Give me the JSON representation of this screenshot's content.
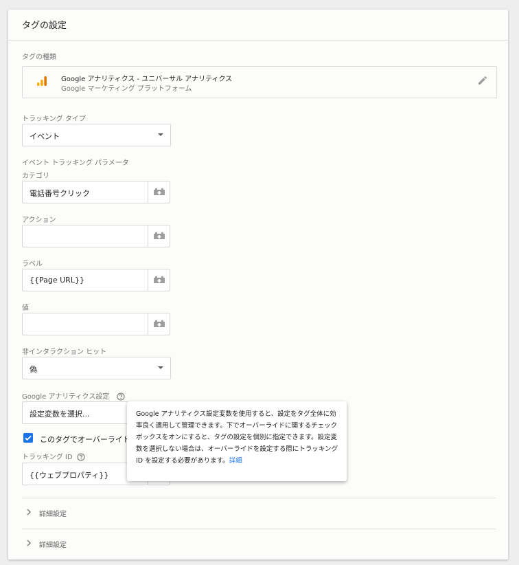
{
  "card": {
    "title": "タグの設定"
  },
  "tag_type": {
    "label": "タグの種類",
    "name": "Google アナリティクス - ユニバーサル アナリティクス",
    "platform": "Google マーケティング プラットフォーム",
    "icon": "analytics-icon",
    "icon_color": "#f9ab00"
  },
  "tracking_type": {
    "label": "トラッキング タイプ",
    "value": "イベント"
  },
  "event_params": {
    "heading": "イベント トラッキング パラメータ",
    "category": {
      "label": "カテゴリ",
      "value": "電話番号クリック"
    },
    "action": {
      "label": "アクション",
      "value": ""
    },
    "event_label": {
      "label": "ラベル",
      "value": "{{Page URL}}"
    },
    "value": {
      "label": "値",
      "value": ""
    }
  },
  "non_interaction": {
    "label": "非インタラクション ヒット",
    "value": "偽"
  },
  "ga_settings": {
    "label": "Google アナリティクス設定",
    "value": "設定変数を選択..."
  },
  "override": {
    "label": "このタグでオーバーライド設",
    "checked": true
  },
  "tracking_id": {
    "label": "トラッキング ID",
    "value": "{{ウェブプロパティ}}"
  },
  "tooltip": {
    "text": "Google アナリティクス設定変数を使用すると、設定をタグ全体に効率良く適用して管理できます。下でオーバーライドに関するチェックボックスをオンにすると、タグの設定を個別に指定できます。設定変数を選択しない場合は、オーバーライドを設定する際にトラッキング ID を設定する必要があります。",
    "link": "詳細"
  },
  "advanced": [
    {
      "label": "詳細設定"
    },
    {
      "label": "詳細設定"
    }
  ],
  "colors": {
    "accent": "#1a73e8",
    "analytics": "#f9ab00"
  }
}
